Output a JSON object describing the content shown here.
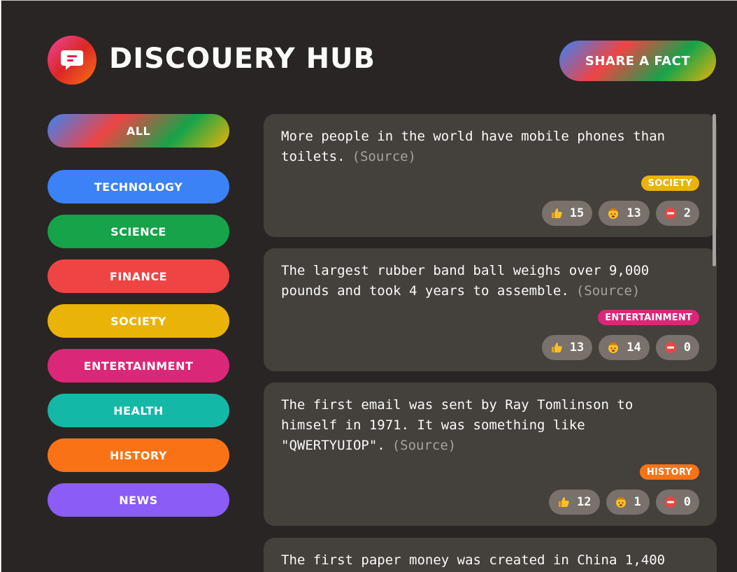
{
  "header": {
    "brand": "DISCOUERY HUB",
    "share_label": "SHARE A FACT"
  },
  "categories": [
    {
      "label": "ALL",
      "color": "gradient"
    },
    {
      "label": "TECHNOLOGY",
      "color": "#3b82f6"
    },
    {
      "label": "SCIENCE",
      "color": "#16a34a"
    },
    {
      "label": "FINANCE",
      "color": "#ef4444"
    },
    {
      "label": "SOCIETY",
      "color": "#eab308"
    },
    {
      "label": "ENTERTAINMENT",
      "color": "#db2777"
    },
    {
      "label": "HEALTH",
      "color": "#14b8a6"
    },
    {
      "label": "HISTORY",
      "color": "#f97316"
    },
    {
      "label": "NEWS",
      "color": "#8b5cf6"
    }
  ],
  "facts": [
    {
      "text": "More people in the world have mobile phones than toilets.",
      "source_label": "(Source)",
      "tag": "SOCIETY",
      "tag_color": "#eab308",
      "votes": {
        "interesting": "15",
        "mindblowing": "13",
        "false": "2"
      }
    },
    {
      "text": "The largest rubber band ball weighs over 9,000 pounds and took 4 years to assemble.",
      "source_label": "(Source)",
      "tag": "ENTERTAINMENT",
      "tag_color": "#db2777",
      "votes": {
        "interesting": "13",
        "mindblowing": "14",
        "false": "0"
      }
    },
    {
      "text": "The first email was sent by Ray Tomlinson to himself in 1971. It was something like \"QWERTYUIOP\".",
      "source_label": "(Source)",
      "tag": "HISTORY",
      "tag_color": "#f97316",
      "votes": {
        "interesting": "12",
        "mindblowing": "1",
        "false": "0"
      }
    },
    {
      "text": "The first paper money was created in China 1,400",
      "source_label": "",
      "tag": "",
      "tag_color": "",
      "votes": null
    }
  ],
  "icons": {
    "logo": "chat-bubble-icon",
    "interesting": "thumbs-up-icon",
    "mindblowing": "exploding-head-icon",
    "false": "no-entry-icon"
  }
}
